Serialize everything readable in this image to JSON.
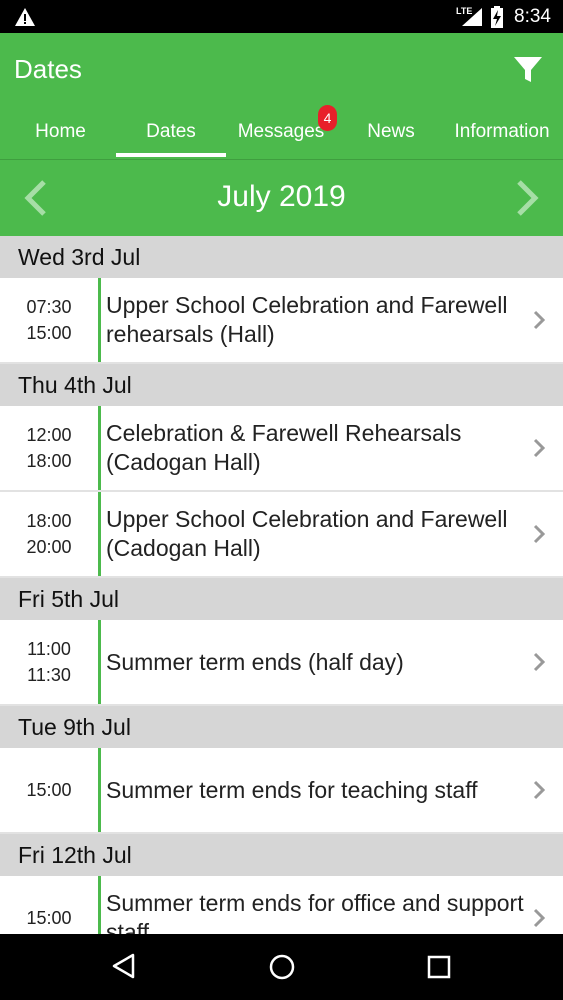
{
  "status": {
    "time": "8:34",
    "network": "LTE"
  },
  "header": {
    "title": "Dates"
  },
  "tabs": [
    {
      "label": "Home"
    },
    {
      "label": "Dates"
    },
    {
      "label": "Messages",
      "badge": "4"
    },
    {
      "label": "News"
    },
    {
      "label": "Information"
    }
  ],
  "month": {
    "label": "July 2019"
  },
  "days": [
    {
      "label": "Wed 3rd Jul",
      "events": [
        {
          "start": "07:30",
          "end": "15:00",
          "title": "Upper School Celebration and Farewell rehearsals (Hall)"
        }
      ]
    },
    {
      "label": "Thu 4th Jul",
      "events": [
        {
          "start": "12:00",
          "end": "18:00",
          "title": "Celebration & Farewell Rehearsals (Cadogan Hall)"
        },
        {
          "start": "18:00",
          "end": "20:00",
          "title": "Upper School Celebration and Farewell (Cadogan Hall)"
        }
      ]
    },
    {
      "label": "Fri 5th Jul",
      "events": [
        {
          "start": "11:00",
          "end": "11:30",
          "title": "Summer term ends (half day)"
        }
      ]
    },
    {
      "label": "Tue 9th Jul",
      "events": [
        {
          "start": "",
          "end": "15:00",
          "title": "Summer term ends for teaching staff"
        }
      ]
    },
    {
      "label": "Fri 12th Jul",
      "events": [
        {
          "start": "15:00",
          "end": "",
          "title": "Summer term ends for office and support staff"
        }
      ]
    }
  ],
  "colors": {
    "primary": "#4cba4c",
    "badge": "#e8202a",
    "day_header": "#d6d6d6"
  }
}
